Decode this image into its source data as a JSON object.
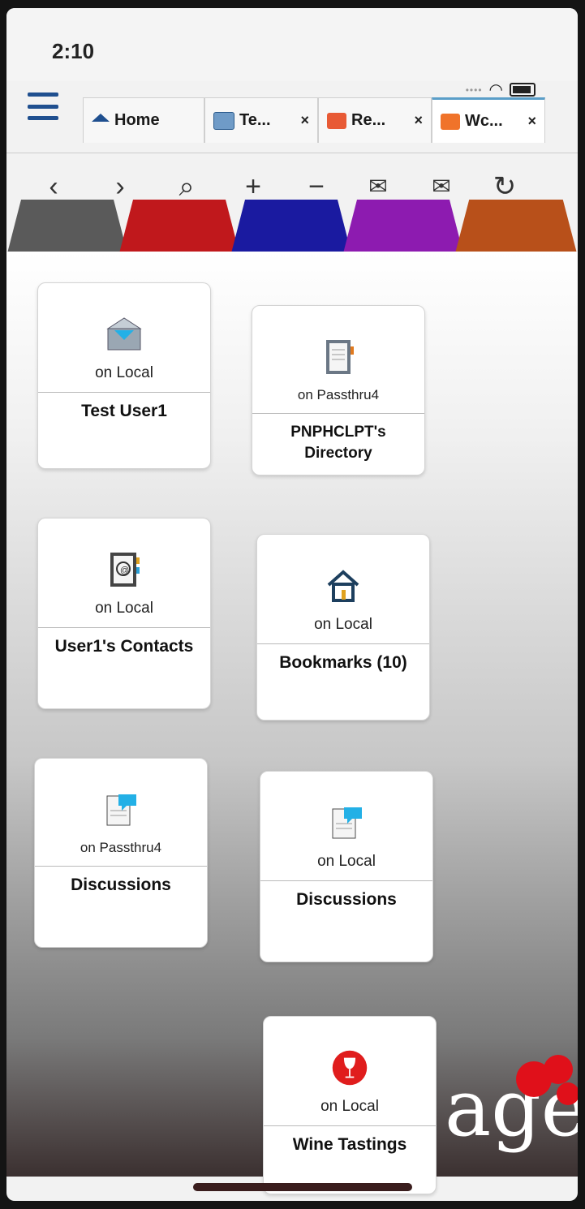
{
  "status": {
    "time": "2:10"
  },
  "tabs": [
    {
      "label": "Home",
      "icon": "home-icon"
    },
    {
      "label": "Te...",
      "icon": "mail-icon"
    },
    {
      "label": "Re...",
      "icon": "folder-icon"
    },
    {
      "label": "Wc...",
      "icon": "folder-icon"
    }
  ],
  "tab_close": "×",
  "toolbar": [
    "back-icon",
    "forward-icon",
    "search-icon",
    "zoom-in-icon",
    "zoom-out-icon",
    "mail-back-icon",
    "mail-forward-icon",
    "refresh-icon"
  ],
  "color_tabs": [
    "#5a5a5a",
    "#c0181c",
    "#1a1aa0",
    "#8d1bb0",
    "#b8501a"
  ],
  "tiles": [
    {
      "sub": "on Local",
      "name": "Test User1",
      "icon": "mail-icon"
    },
    {
      "sub": "on Passthru4",
      "name": "PNPHCLPT's Directory",
      "icon": "directory-icon"
    },
    {
      "sub": "on Local",
      "name": "User1's Contacts",
      "icon": "contacts-icon"
    },
    {
      "sub": "on Local",
      "name": "Bookmarks (10)",
      "icon": "home-icon"
    },
    {
      "sub": "on Passthru4",
      "name": "Discussions",
      "icon": "discussion-icon"
    },
    {
      "sub": "on Local",
      "name": "Discussions",
      "icon": "discussion-icon"
    },
    {
      "sub": "on Local",
      "name": "Wine Tastings",
      "icon": "wine-icon"
    }
  ],
  "brand": "age"
}
